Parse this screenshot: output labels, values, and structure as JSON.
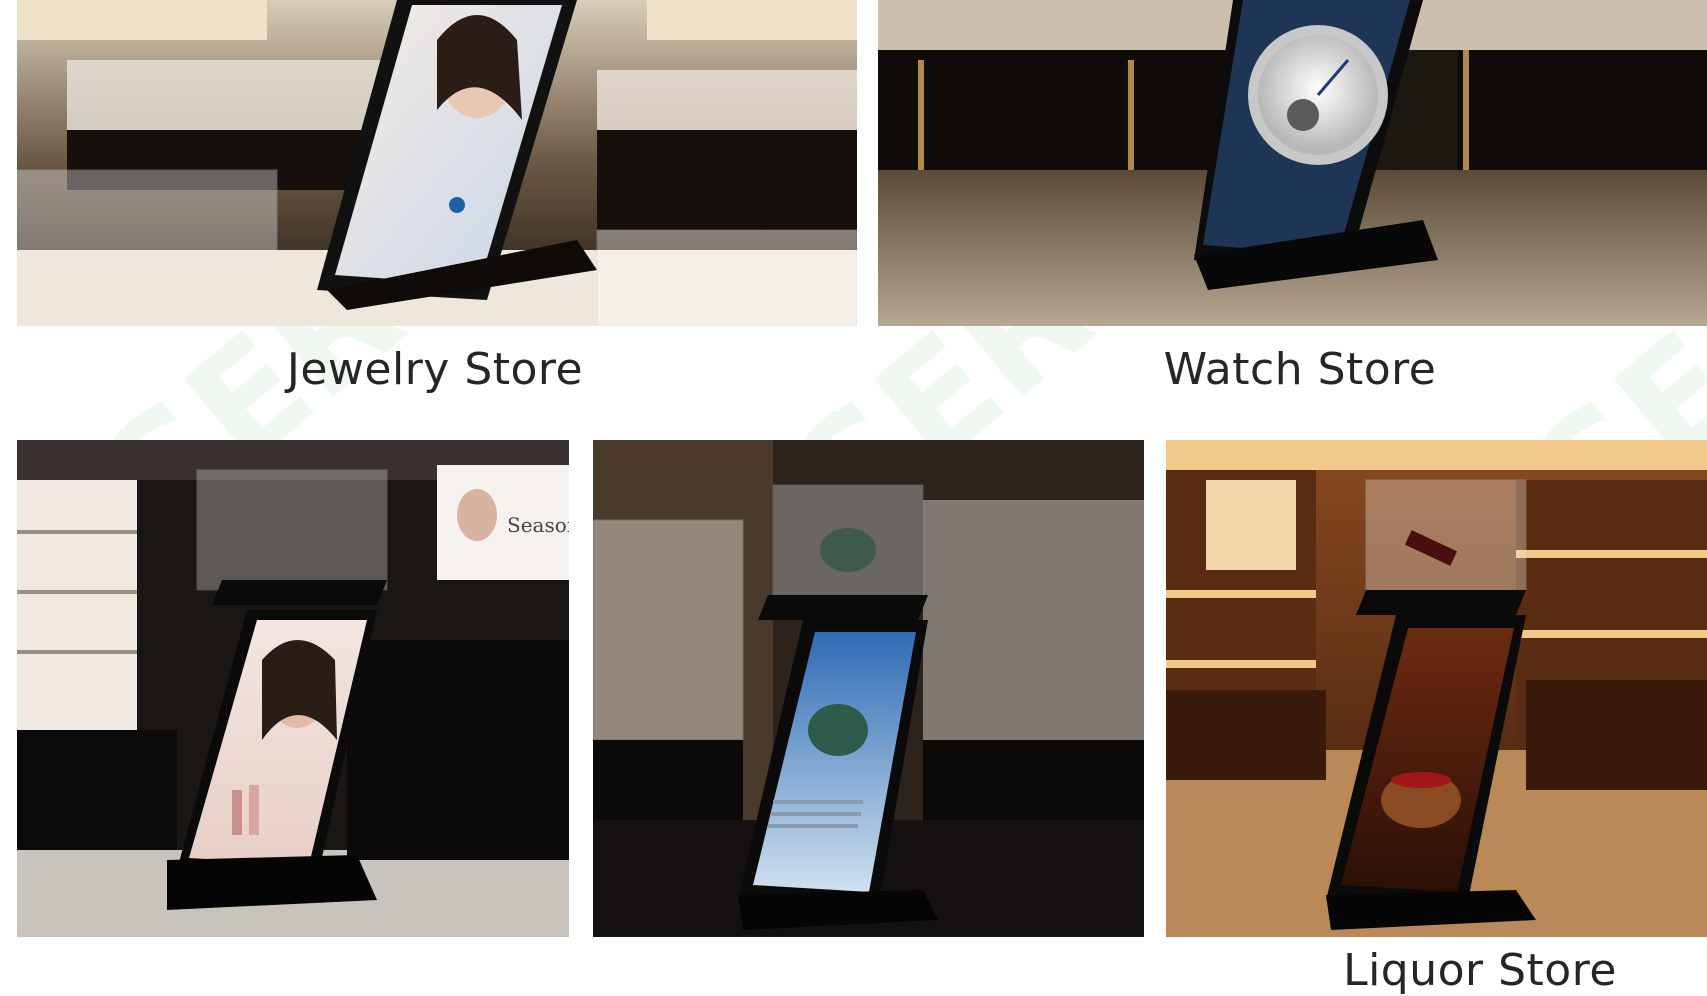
{
  "captions": {
    "jewelry": "Jewelry Store",
    "watch": "Watch Store",
    "liquor_partial": "Liquor Store"
  },
  "screens": {
    "cosmetics_brand": "Season"
  },
  "colors": {
    "background": "#ffffff",
    "caption_text": "#262626",
    "watermark": "#2fae4a"
  }
}
